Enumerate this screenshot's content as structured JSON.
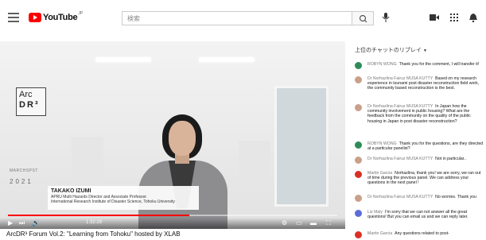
{
  "header": {
    "logo_text": "YouTube",
    "logo_sup": "JP",
    "search_placeholder": "検索"
  },
  "video": {
    "logo_line1": "Arc",
    "logo_line2": "DR³",
    "side_text": "MARCHSPST",
    "year": "2021",
    "speaker_name": "TAKAKO IZUMI",
    "speaker_title1": "APRU Multi Hazards Director and Associate Professor",
    "speaker_title2": "International Research Institute of Disaster Science, Tohoku University",
    "time": "1:32:29",
    "progress": 0.55,
    "title": "ArcDR³ Forum Vol.2: \"Learning from Tohoku\" hosted by XLAB"
  },
  "chat": {
    "header": "上位のチャットのリプレイ",
    "messages": [
      {
        "author": "ROBYN WONG",
        "text": "Thank you for the comment, I will transfer it!",
        "color": "#2e8b57"
      },
      {
        "author": "Dr Norhazlina Fairuz MUSA KUTTY",
        "text": "Based on my research experience in tsunami post disaster reconstruction field work, the community based reconstruction is the best.",
        "color": "#c9a08a"
      },
      {
        "author": "Dr Norhazlina Fairuz MUSA KUTTY",
        "text": "In Japan how the community involvement in public housing? What are the feedback from the community on the quality of the public housing in Japan in post disaster reconstruction?",
        "color": "#c9a08a"
      },
      {
        "author": "ROBYN WONG",
        "text": "Thank you for the questions, are they directed at a particular panelist?",
        "color": "#2e8b57"
      },
      {
        "author": "Dr Norhazlina Fairuz MUSA KUTTY",
        "text": "Not in particular..",
        "color": "#c9a08a"
      },
      {
        "author": "Martin Garcia",
        "text": "Norhazlina, thank you! we are sorry, we ran out of time during the previous panel. We can address your questions in the next panel !",
        "color": "#d93025"
      },
      {
        "author": "Dr Norhazlina Fairuz MUSA KUTTY",
        "text": "No worries. Thank you",
        "color": "#c9a08a"
      },
      {
        "author": "Liz Maly",
        "text": "I'm sorry that we can not answer all the great questions! But you can email us and we can reply later.",
        "color": "#5b6bd6"
      },
      {
        "author": "Martin Garcia",
        "text": "Any questions related to post-",
        "color": "#d93025"
      }
    ]
  }
}
